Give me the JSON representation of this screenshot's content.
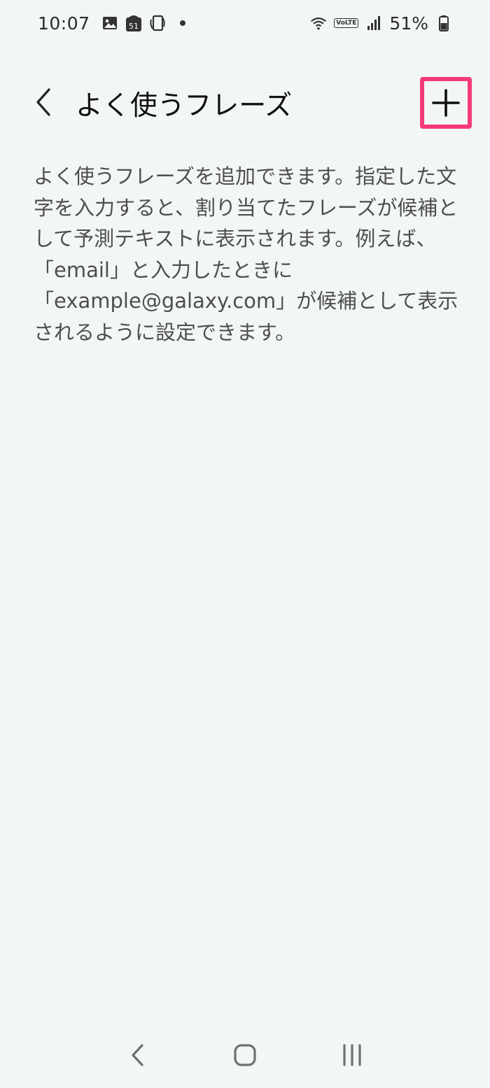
{
  "status_bar": {
    "time": "10:07",
    "battery": "51%",
    "notification_badge": "51",
    "network_badge": "VoLTE"
  },
  "header": {
    "title": "よく使うフレーズ",
    "back_icon": "chevron-left-icon",
    "add_icon": "plus-icon",
    "highlight_color": "#f53a7a"
  },
  "main": {
    "description": "よく使うフレーズを追加できます。指定した文字を入力すると、割り当てたフレーズが候補として予測テキストに表示されます。例えば、「email」と入力したときに\n「example@galaxy.com」が候補として表示されるように設定できます。"
  },
  "nav_bar": {
    "back_icon": "nav-back-icon",
    "home_icon": "nav-home-icon",
    "recents_icon": "nav-recents-icon"
  }
}
